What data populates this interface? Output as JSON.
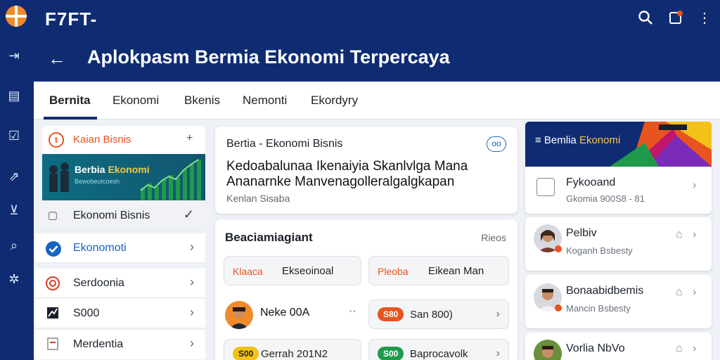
{
  "app": {
    "brand": "F7FT-"
  },
  "header": {
    "title": "Aplokpasm Bermia Ekonomi Terpercaya"
  },
  "tabs": [
    {
      "label": "Bernita",
      "active": true
    },
    {
      "label": "Ekonomi"
    },
    {
      "label": "Bkenis"
    },
    {
      "label": "Nemonti"
    },
    {
      "label": "Ekordyry"
    }
  ],
  "sidebar": {
    "header": "Kaian Bisnis",
    "banner_title_a": "Berbia",
    "banner_title_b": "Ekonomi",
    "banner_sub": "Bewobeutcoesh",
    "items": [
      {
        "label": "Ekonomi Bisnis",
        "icon": "square-icon"
      },
      {
        "label": "Ekonomoti",
        "icon": "check-circle-icon"
      },
      {
        "label": "Serdoonia",
        "icon": "seal-icon"
      },
      {
        "label": "S000",
        "icon": "chart-icon"
      },
      {
        "label": "Merdentia",
        "icon": "doc-icon"
      }
    ]
  },
  "article": {
    "kicker": "Bertia - Ekonomi Bisnis",
    "headline_1": "Kedoabalunaa Ikenaiyia Skanlvlga Mana",
    "headline_2": "Ananarnke Manvenagolleralgalgkapan",
    "meta": "Kenlan Sisaba",
    "more": "oo"
  },
  "panel": {
    "title": "Beaciamiagiant",
    "link": "Rieos",
    "pills": [
      {
        "tag": "Klaaca",
        "text": "Ekseoinoal"
      },
      {
        "tag": "Pleoba",
        "text": "Eikean Man"
      }
    ],
    "person": "Neke 00A",
    "rows": [
      {
        "badge": "S80",
        "text": "San 800)",
        "color": "#e8541f"
      },
      {
        "badge": "S00",
        "text": "Gerrah 201N2",
        "color": "#f3c218"
      },
      {
        "badge": "S00",
        "text": "Baprocavolk",
        "color": "#1f9a4a"
      }
    ]
  },
  "right": {
    "banner_a": "Bemlia",
    "banner_b": "Ekonomi",
    "items": [
      {
        "title": "Fykooand",
        "sub": "Gkomia 900S8 - 81"
      },
      {
        "title": "Pelbiv",
        "sub": "Koganh Bsbesty"
      },
      {
        "title": "Bonaabidbemis",
        "sub": "Mancin Bsbesty"
      },
      {
        "title": "Vorlia NbVo",
        "sub": ""
      }
    ]
  },
  "colors": {
    "primary": "#0f2c73",
    "accent": "#e8541f",
    "link": "#1565c0"
  }
}
